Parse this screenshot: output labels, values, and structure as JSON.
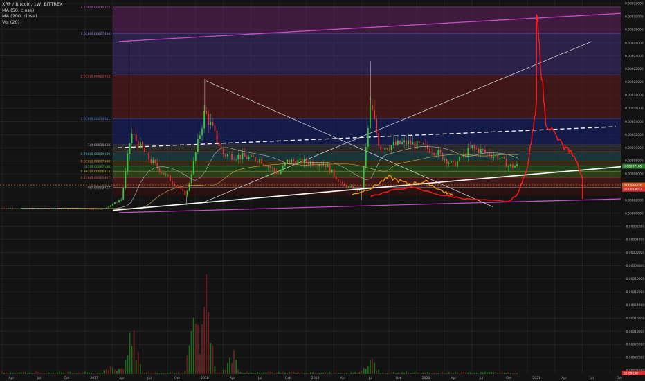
{
  "legend": {
    "symbol": "XRP / Bitcoin, 1W, BITTREX",
    "ma50": "MA (50, close)",
    "ma200": "MA (200, close)",
    "vol": "Vol (20)"
  },
  "colors": {
    "background": "#131313",
    "grid": "#2a2a2a",
    "up": "#37c837",
    "down": "#e23b3b",
    "red_line": "#ff1a1a",
    "orange_line": "#f4a21a",
    "channel": "#d050d0",
    "trendline": "#ffffff",
    "price_dash": "#ff8c00"
  },
  "price_axis_labels": [
    "0.00032000",
    "0.00030000",
    "0.00028000",
    "0.00026000",
    "0.00024000",
    "0.00022000",
    "0.00020000",
    "0.00018000",
    "0.00016000",
    "0.00014000",
    "0.00012000",
    "0.00010000",
    "0.00008000",
    "0.00006000",
    "0.00004000",
    "0.00002000",
    "0.00000000",
    "-0.00002000",
    "-0.00004000",
    "-0.00006000",
    "-0.00008000",
    "-0.00010000",
    "-0.00012000",
    "-0.00014000",
    "-0.00016000",
    "-0.00018000",
    "-0.00020000",
    "-0.00022000",
    "-0.00024000"
  ],
  "price_tags": {
    "current": "0.00004310",
    "second": "0.00003657",
    "level_1": "0.00007165",
    "bottom": "32.09538"
  },
  "time_axis_labels": [
    "Apr",
    "Jul",
    "Oct",
    "2017",
    "Apr",
    "Jul",
    "Oct",
    "2018",
    "Apr",
    "Jul",
    "Oct",
    "2019",
    "Apr",
    "Jul",
    "Oct",
    "2020",
    "Apr",
    "Jul",
    "Oct",
    "2021",
    "Apr",
    "Jul",
    "Oct"
  ],
  "fib_labels": [
    {
      "label": "4.236(0.00031472)",
      "color": "#c868c8"
    },
    {
      "label": "3.618(0.00027454)",
      "color": "#9a9aff"
    },
    {
      "label": "2.618(0.00020953)",
      "color": "#e05050"
    },
    {
      "label": "1.618(0.00014451)",
      "color": "#5a7adf"
    },
    {
      "label": "1(0.00010434)",
      "color": "#b8b8b8"
    },
    {
      "label": "0.786(0.00009049)",
      "color": "#5abcbc"
    },
    {
      "label": "0.618(0.00007946)",
      "color": "#e8a030"
    },
    {
      "label": "0.5(0.00007180)",
      "color": "#50c050"
    },
    {
      "label": "0.382(0.00006413)",
      "color": "#c8c030"
    },
    {
      "label": "0.236(0.00005467)",
      "color": "#e06060"
    },
    {
      "label": "0(0.00003927)",
      "color": "#b0b0b0"
    }
  ],
  "chart_data": {
    "type": "candlestick",
    "symbol": "XRP / Bitcoin",
    "interval": "1W",
    "exchange": "BITTREX",
    "y_axis": "price (BTC)",
    "ylim": [
      -0.00024,
      0.00032
    ],
    "x_range": [
      "2016-03",
      "2021-10"
    ],
    "grid": true,
    "fibonacci_levels": [
      {
        "ratio": 4.236,
        "price": 0.00031472
      },
      {
        "ratio": 3.618,
        "price": 0.00027454
      },
      {
        "ratio": 2.618,
        "price": 0.00020953
      },
      {
        "ratio": 1.618,
        "price": 0.00014451
      },
      {
        "ratio": 1.0,
        "price": 0.00010434
      },
      {
        "ratio": 0.786,
        "price": 9.049e-05
      },
      {
        "ratio": 0.618,
        "price": 7.946e-05
      },
      {
        "ratio": 0.5,
        "price": 7.18e-05
      },
      {
        "ratio": 0.382,
        "price": 6.413e-05
      },
      {
        "ratio": 0.236,
        "price": 5.467e-05
      },
      {
        "ratio": 0.0,
        "price": 3.927e-05
      }
    ],
    "close_key_points": [
      {
        "date": "2016-03",
        "close": 8e-06
      },
      {
        "date": "2016-09",
        "close": 7.2e-06
      },
      {
        "date": "2017-02",
        "close": 6.2e-06
      },
      {
        "date": "2017-04",
        "close": 2.2e-05
      },
      {
        "date": "2017-05",
        "close": 0.000122
      },
      {
        "date": "2017-07",
        "close": 8.2e-05
      },
      {
        "date": "2017-11",
        "close": 2.7e-05
      },
      {
        "date": "2018-01",
        "close": 0.000155
      },
      {
        "date": "2018-03",
        "close": 9e-05
      },
      {
        "date": "2018-07",
        "close": 8.2e-05
      },
      {
        "date": "2018-09",
        "close": 6e-05
      },
      {
        "date": "2018-10",
        "close": 8e-05
      },
      {
        "date": "2019-02",
        "close": 7.6e-05
      },
      {
        "date": "2019-04",
        "close": 4.2e-05
      },
      {
        "date": "2019-06",
        "close": 3.4e-05
      },
      {
        "date": "2019-07",
        "close": 0.000165
      },
      {
        "date": "2019-08",
        "close": 0.0001
      },
      {
        "date": "2019-11",
        "close": 0.000108
      },
      {
        "date": "2020-02",
        "close": 9.5e-05
      },
      {
        "date": "2020-04",
        "close": 7.3e-05
      },
      {
        "date": "2020-06",
        "close": 0.0001
      },
      {
        "date": "2020-09",
        "close": 8.5e-05
      },
      {
        "date": "2020-10",
        "close": 7.2e-05
      }
    ],
    "red_line_points": [
      {
        "date": "2019-07",
        "close": 2.6e-05
      },
      {
        "date": "2019-11",
        "close": 4e-05
      },
      {
        "date": "2020-03",
        "close": 2.7e-05
      },
      {
        "date": "2020-06",
        "close": 2.1e-05
      },
      {
        "date": "2020-10",
        "close": 1.8e-05
      },
      {
        "date": "2020-11",
        "close": 3e-05
      },
      {
        "date": "2020-12",
        "close": 7e-05
      },
      {
        "date": "2021-01",
        "close": 0.000165
      },
      {
        "date": "2021-01",
        "close": 0.000305
      },
      {
        "date": "2021-02",
        "close": 0.00014
      },
      {
        "date": "2021-04",
        "close": 0.0001
      },
      {
        "date": "2021-05",
        "close": 9e-05
      },
      {
        "date": "2021-06",
        "close": 5.5e-05
      },
      {
        "date": "2021-06",
        "close": 2.2e-05
      }
    ],
    "orange_line_points": [
      {
        "date": "2019-05",
        "close": 2.8e-05
      },
      {
        "date": "2019-07",
        "close": 3.8e-05
      },
      {
        "date": "2019-09",
        "close": 5.5e-05
      },
      {
        "date": "2019-11",
        "close": 4.5e-05
      },
      {
        "date": "2020-01",
        "close": 4.8e-05
      },
      {
        "date": "2020-03",
        "close": 3.2e-05
      },
      {
        "date": "2020-04",
        "close": 2.8e-05
      }
    ],
    "volume_key_points": [
      {
        "date": "2017-03",
        "volume": 0.15
      },
      {
        "date": "2017-05",
        "volume": 0.55
      },
      {
        "date": "2017-12",
        "volume": 0.7
      },
      {
        "date": "2018-01",
        "volume": 1.0
      },
      {
        "date": "2018-04",
        "volume": 0.25
      },
      {
        "date": "2019-07",
        "volume": 0.2
      },
      {
        "date": "2021-01",
        "volume": 0.15
      }
    ]
  }
}
